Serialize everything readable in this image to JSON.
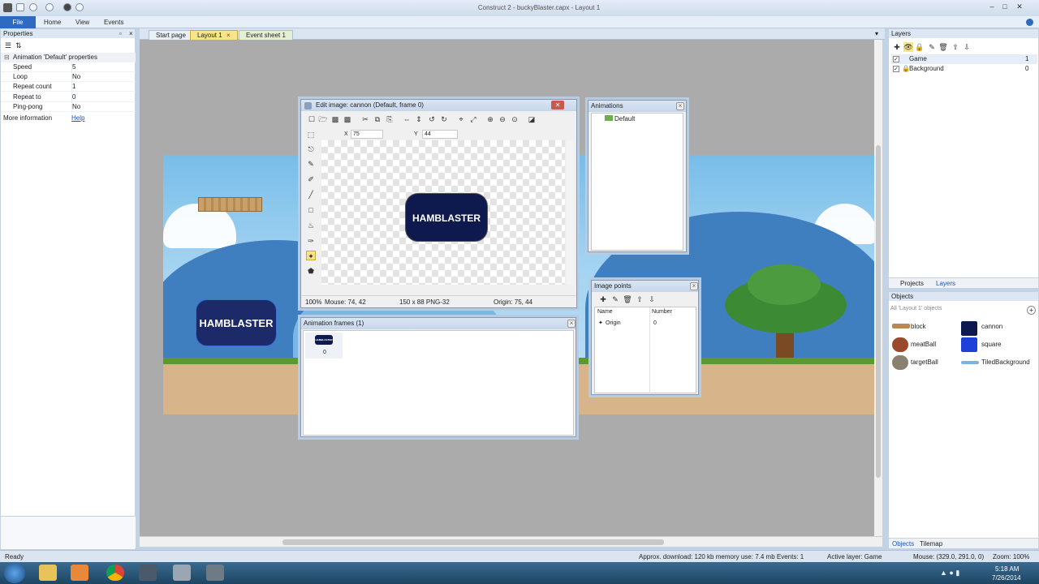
{
  "window": {
    "title": "Construct 2 - buckyBlaster.capx - Layout 1"
  },
  "ribbon": {
    "file": "File",
    "tabs": [
      "Home",
      "View",
      "Events"
    ]
  },
  "properties": {
    "header": "Properties",
    "section": "Animation 'Default' properties",
    "rows": [
      {
        "key": "Speed",
        "value": "5"
      },
      {
        "key": "Loop",
        "value": "No"
      },
      {
        "key": "Repeat count",
        "value": "1"
      },
      {
        "key": "Repeat to",
        "value": "0"
      },
      {
        "key": "Ping-pong",
        "value": "No"
      }
    ],
    "more_info_label": "More information",
    "more_info_link": "Help"
  },
  "doc_tabs": [
    "Start page",
    "Layout 1",
    "Event sheet 1"
  ],
  "canvas": {
    "sprite_text": "HAMBLASTER"
  },
  "edit_image": {
    "title": "Edit image: cannon (Default, frame 0)",
    "x_label": "X",
    "x_value": "75",
    "y_label": "Y",
    "y_value": "44",
    "sprite_text": "HAMBLASTER",
    "status_zoom": "100%",
    "status_mouse": "Mouse: 74, 42",
    "status_size": "150 x 88 PNG-32",
    "status_origin": "Origin: 75, 44"
  },
  "animations": {
    "title": "Animations",
    "items": [
      "Default"
    ]
  },
  "animation_frames": {
    "title": "Animation frames (1)",
    "frames": [
      {
        "index": "0",
        "thumb_text": "HAMBLASTER"
      }
    ]
  },
  "image_points": {
    "title": "Image points",
    "columns": [
      "Name",
      "Number"
    ],
    "rows": [
      {
        "name": "Origin",
        "number": "0"
      }
    ]
  },
  "layers": {
    "header": "Layers",
    "items": [
      {
        "name": "Game",
        "number": "1"
      },
      {
        "name": "Background",
        "number": "0"
      }
    ],
    "tabs": [
      "Projects",
      "Layers"
    ]
  },
  "objects": {
    "header": "Objects",
    "filter": "All 'Layout 1' objects",
    "items": [
      {
        "name": "block",
        "icon": "wood-plank"
      },
      {
        "name": "cannon",
        "icon": "hamblaster-sprite"
      },
      {
        "name": "meatBall",
        "icon": "meatball"
      },
      {
        "name": "square",
        "icon": "blue-square"
      },
      {
        "name": "targetBall",
        "icon": "target-ball"
      },
      {
        "name": "TiledBackground",
        "icon": "tiled-strip"
      }
    ],
    "tabs": [
      "Objects",
      "Tilemap"
    ]
  },
  "statusbar": {
    "ready": "Ready",
    "download": "Approx. download: 120 kb  memory use: 7.4 mb  Events: 1",
    "active_layer": "Active layer: Game",
    "mouse": "Mouse: (329.0, 291.0, 0)",
    "zoom": "Zoom: 100%"
  },
  "taskbar": {
    "time": "5:18 AM",
    "date": "7/26/2014"
  },
  "colors": {
    "file_button": "#2e6bc0",
    "sprite_bg": "#0e1a4d",
    "sky": "#78bde8",
    "grass": "#5c9a2f",
    "dirt": "#d8b48a",
    "layout_bg": "#ababab"
  }
}
